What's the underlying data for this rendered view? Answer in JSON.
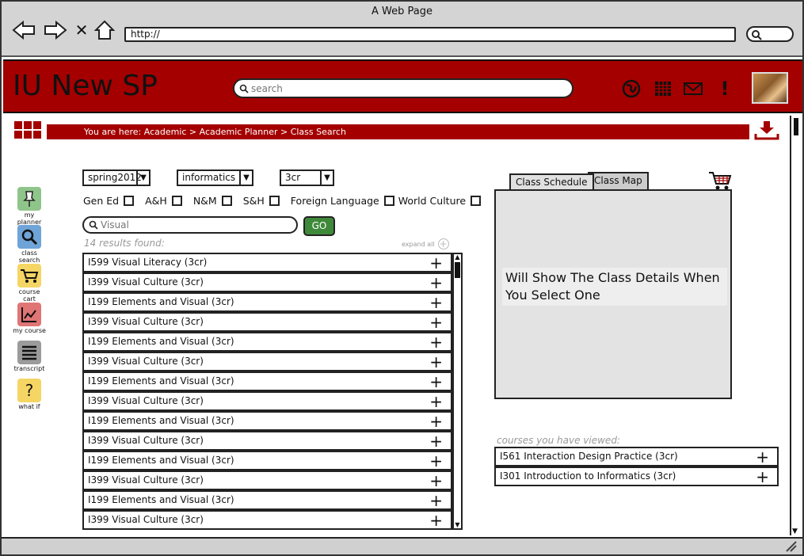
{
  "window": {
    "title": "A Web Page"
  },
  "browser": {
    "url": "http://"
  },
  "app": {
    "title": "IU New SP",
    "search_placeholder": "search"
  },
  "header_icons": [
    "globe-icon",
    "calendar-icon",
    "mail-icon",
    "alert-icon"
  ],
  "breadcrumb": "You are here: Academic > Academic Planner > Class Search",
  "leftnav": [
    {
      "label": "my planner",
      "icon": "pin-icon",
      "color": "#8fc58a"
    },
    {
      "label": "class search",
      "icon": "magnifier-icon",
      "color": "#6fa4d8"
    },
    {
      "label": "course cart",
      "icon": "cart-icon",
      "color": "#f5d564"
    },
    {
      "label": "my course",
      "icon": "chart-icon",
      "color": "#e07575"
    },
    {
      "label": "transcript",
      "icon": "list-icon",
      "color": "#9b9b9b"
    },
    {
      "label": "what if",
      "icon": "question-icon",
      "color": "#f5d564"
    }
  ],
  "filters": {
    "term": "spring2012",
    "department": "informatics",
    "credits": "3cr",
    "checkboxes": [
      "Gen Ed",
      "A&H",
      "N&M",
      "S&H",
      "Foreign Language",
      "World Culture"
    ],
    "search_placeholder": "Visual",
    "go_label": "GO"
  },
  "results": {
    "count_text": "14 results found:",
    "expand_all": "expand all",
    "items": [
      "I599 Visual Literacy (3cr)",
      "I399 Visual Culture (3cr)",
      "I199 Elements and Visual (3cr)",
      "I399 Visual Culture (3cr)",
      "I199 Elements and Visual (3cr)",
      "I399 Visual Culture (3cr)",
      "I199 Elements and Visual (3cr)",
      "I399 Visual Culture (3cr)",
      "I199 Elements and Visual (3cr)",
      "I399 Visual Culture (3cr)",
      "I199 Elements and Visual (3cr)",
      "I399 Visual Culture (3cr)",
      "I199 Elements and Visual (3cr)",
      "I399 Visual Culture (3cr)"
    ]
  },
  "detail": {
    "tabs": [
      "Class Schedule",
      "Class Map"
    ],
    "placeholder": "Will Show The Class Details When You Select One"
  },
  "viewed": {
    "label": "courses you have viewed:",
    "items": [
      "I561 Interaction Design Practice (3cr)",
      "I301 Introduction to Informatics (3cr)"
    ]
  }
}
